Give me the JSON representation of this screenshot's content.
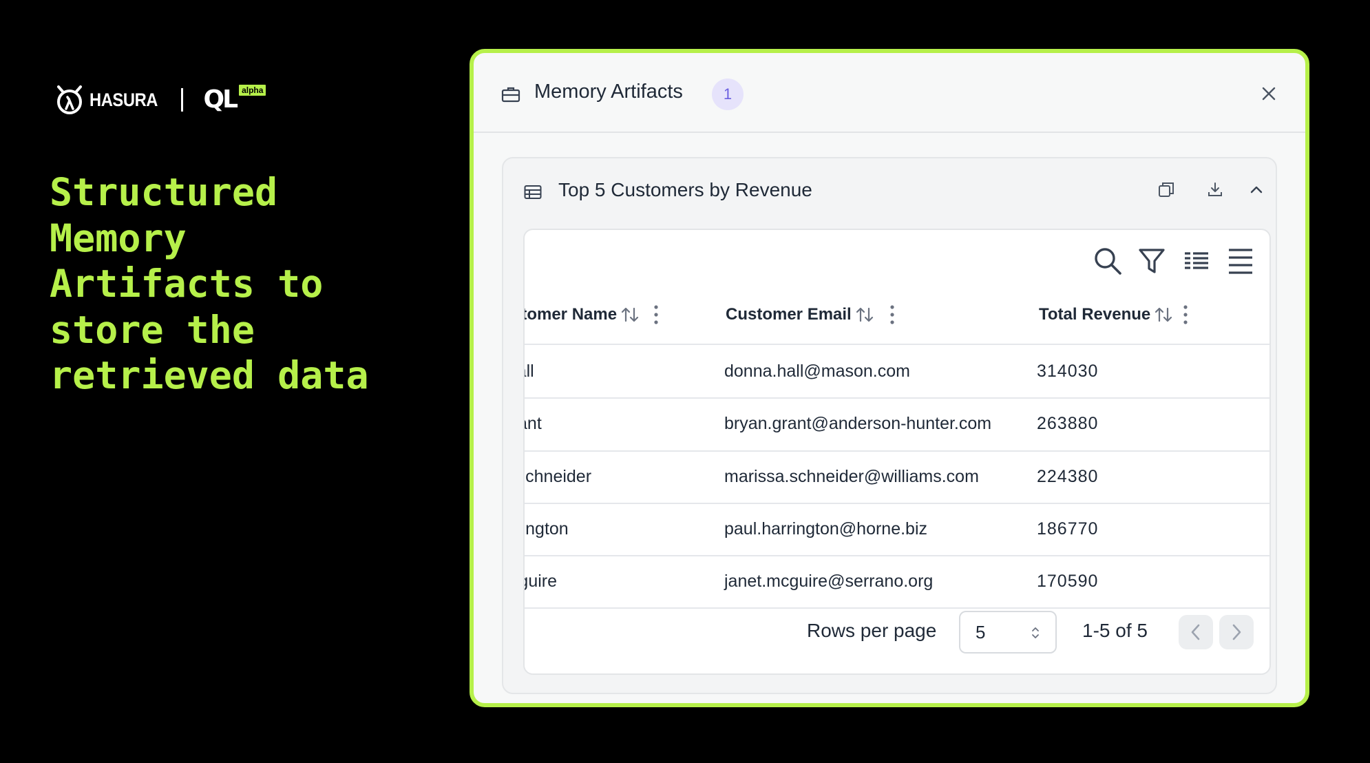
{
  "brand": {
    "name": "HASURA",
    "product": "QL",
    "stage": "alpha"
  },
  "headline": "Structured Memory Artifacts to store the retrieved data",
  "panel": {
    "title": "Memory Artifacts",
    "badge": "1",
    "icons": [
      "briefcase-icon",
      "close-icon"
    ]
  },
  "artifact": {
    "title": "Top 5 Customers by Revenue",
    "icons": [
      "table-icon",
      "copy-icon",
      "download-icon",
      "chevron-up-icon"
    ]
  },
  "table": {
    "toolbar": [
      "search-icon",
      "filter-icon",
      "columns-icon",
      "density-icon"
    ],
    "columns": [
      {
        "label": "Customer Name"
      },
      {
        "label": "Customer Email"
      },
      {
        "label": "Total Revenue"
      }
    ],
    "rows": [
      {
        "name": "Donna Hall",
        "email": "donna.hall@mason.com",
        "revenue": "314030"
      },
      {
        "name": "Bryan Grant",
        "email": "bryan.grant@anderson-hunter.com",
        "revenue": "263880"
      },
      {
        "name": "Marissa Schneider",
        "email": "marissa.schneider@williams.com",
        "revenue": "224380"
      },
      {
        "name": "Paul Harrington",
        "email": "paul.harrington@horne.biz",
        "revenue": "186770"
      },
      {
        "name": "Janet Mcguire",
        "email": "janet.mcguire@serrano.org",
        "revenue": "170590"
      }
    ]
  },
  "pagination": {
    "rows_per_page_label": "Rows per page",
    "rows_per_page": "5",
    "range": "1-5 of 5"
  },
  "colors": {
    "accent": "#b6f04a",
    "badge_bg": "#e6e3fb",
    "badge_text": "#6b5fe0"
  }
}
